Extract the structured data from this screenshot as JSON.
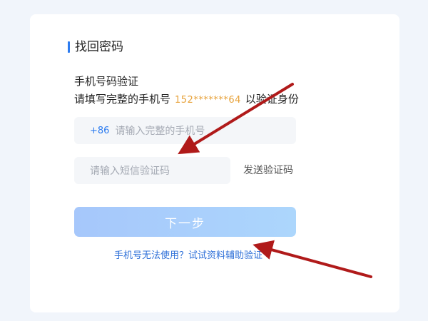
{
  "header": {
    "title": "找回密码"
  },
  "verify": {
    "heading": "手机号码验证",
    "desc_prefix": "请填写完整的手机号",
    "masked_phone": "152*******64",
    "desc_suffix": "以验证身份"
  },
  "phone_input": {
    "prefix": "+86",
    "placeholder": "请输入完整的手机号"
  },
  "code_input": {
    "placeholder": "请输入短信验证码"
  },
  "send_code_label": "发送验证码",
  "next_button": {
    "label": "下一步"
  },
  "alt_link": "手机号无法使用？试试资料辅助验证",
  "colors": {
    "accent": "#2d7cf0",
    "masked_phone": "#e7a23a",
    "button_start": "#a6c7fb",
    "button_end": "#acd6fc",
    "arrow": "#b01a1a"
  }
}
